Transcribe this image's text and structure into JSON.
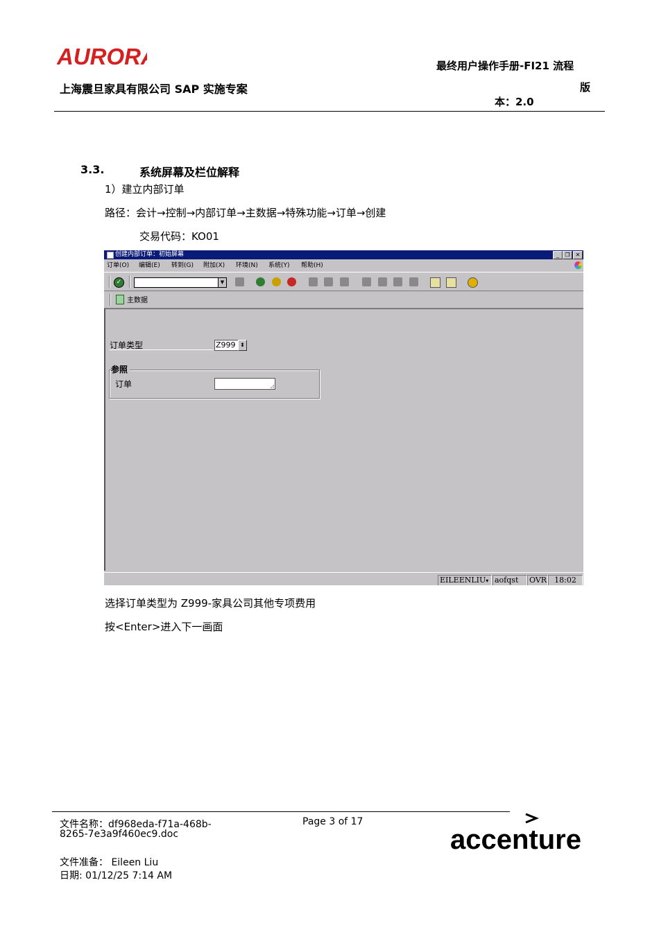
{
  "header": {
    "logo_text": "AURORA",
    "company": "上海震旦家具有限公司 SAP 实施专案",
    "doc_title": "最终用户操作手册-FI21 流程",
    "version_label_a": "版",
    "version_label_b": "本：2.0",
    "accent_color": "#d42020"
  },
  "section": {
    "number": "3.3.",
    "title": "系统屏幕及栏位解释",
    "step": "1）建立内部订单",
    "path": "路径：会计→控制→内部订单→主数据→特殊功能→订单→创建",
    "tcode": "交易代码：KO01",
    "instruction1": "选择订单类型为 Z999-家具公司其他专项费用",
    "instruction2": "按<Enter>进入下一画面"
  },
  "sap": {
    "window_title": "创建内部订单：初始屏幕",
    "menu": [
      "订单(O)",
      "编辑(E)",
      "转到(G)",
      "附加(X)",
      "环境(N)",
      "系统(Y)",
      "帮助(H)"
    ],
    "app_button": "主数据",
    "order_type_label": "订单类型",
    "order_type_value": "Z999",
    "group_title": "参照",
    "order_label": "订单",
    "status": {
      "user": "EILEENLIU",
      "client": "aofqst",
      "mode": "OVR",
      "time": "18:02"
    }
  },
  "footer": {
    "file_name": "文件名称：df968eda-f71a-468b-",
    "file_name2": "8265-7e3a9f460ec9.doc",
    "page": "Page 3 of 17",
    "prepared_by": "文件准备：  Eileen Liu",
    "date": "日期:          01/12/25 7:14 AM",
    "brand": "accenture"
  }
}
